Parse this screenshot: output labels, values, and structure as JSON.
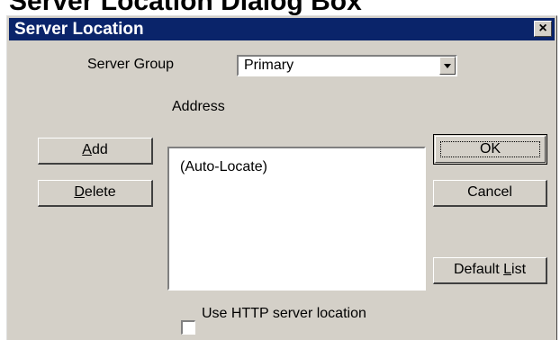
{
  "document_title": "Server Location Dialog Box",
  "dialog": {
    "title": "Server Location",
    "close_glyph": "×",
    "server_group_label": "Server Group",
    "server_group_value": "Primary",
    "address_label": "Address",
    "addresses": [
      "(Auto-Locate)"
    ],
    "add_button": {
      "mnemonic": "A",
      "rest": "dd"
    },
    "delete_button": {
      "mnemonic": "D",
      "rest": "elete"
    },
    "ok_button": "OK",
    "cancel_button": "Cancel",
    "default_list_button": {
      "prefix": "Default ",
      "mnemonic": "L",
      "rest": "ist"
    },
    "http_checkbox_label": "Use HTTP server location",
    "http_checkbox_checked": false
  },
  "icons": {
    "close": "close-icon",
    "dropdown": "chevron-down-icon"
  },
  "colors": {
    "title_bar": "#0a246a",
    "dialog_face": "#d4d0c8"
  }
}
